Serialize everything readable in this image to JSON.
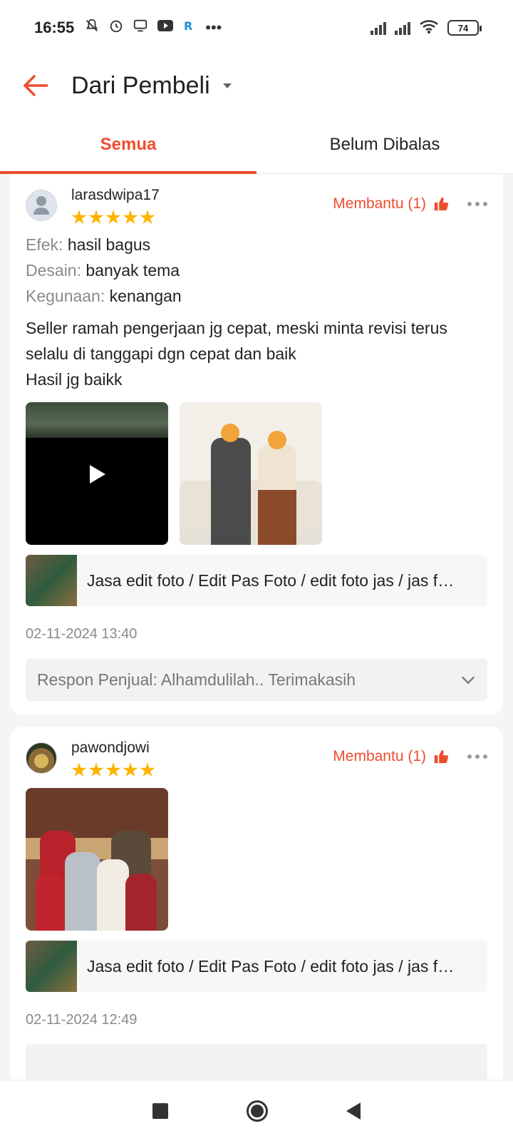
{
  "status_bar": {
    "time": "16:55",
    "dots": "•••",
    "battery": "74"
  },
  "header": {
    "title": "Dari Pembeli"
  },
  "tabs": [
    {
      "label": "Semua",
      "active": true
    },
    {
      "label": "Belum Dibalas",
      "active": false
    }
  ],
  "reviews": [
    {
      "username": "larasdwipa17",
      "rating": 5,
      "helpful_label": "Membantu (1)",
      "attributes": [
        {
          "label": "Efek:",
          "value": "hasil bagus"
        },
        {
          "label": "Desain:",
          "value": "banyak tema"
        },
        {
          "label": "Kegunaan:",
          "value": "kenangan"
        }
      ],
      "comment": "Seller ramah pengerjaan jg cepat, meski minta revisi terus selalu di tanggapi dgn cepat dan baik\nHasil jg baikk",
      "product_name": "Jasa edit foto / Edit Pas Foto / edit foto jas / jas formal",
      "date": "02-11-2024 13:40",
      "response": "Respon Penjual: Alhamdulilah.. Terimakasih"
    },
    {
      "username": "pawondjowi",
      "rating": 5,
      "helpful_label": "Membantu (1)",
      "product_name": "Jasa edit foto / Edit Pas Foto / edit foto jas / jas formal",
      "date": "02-11-2024 12:49"
    }
  ],
  "colors": {
    "accent": "#ee4d2d",
    "star": "#ffb400"
  }
}
